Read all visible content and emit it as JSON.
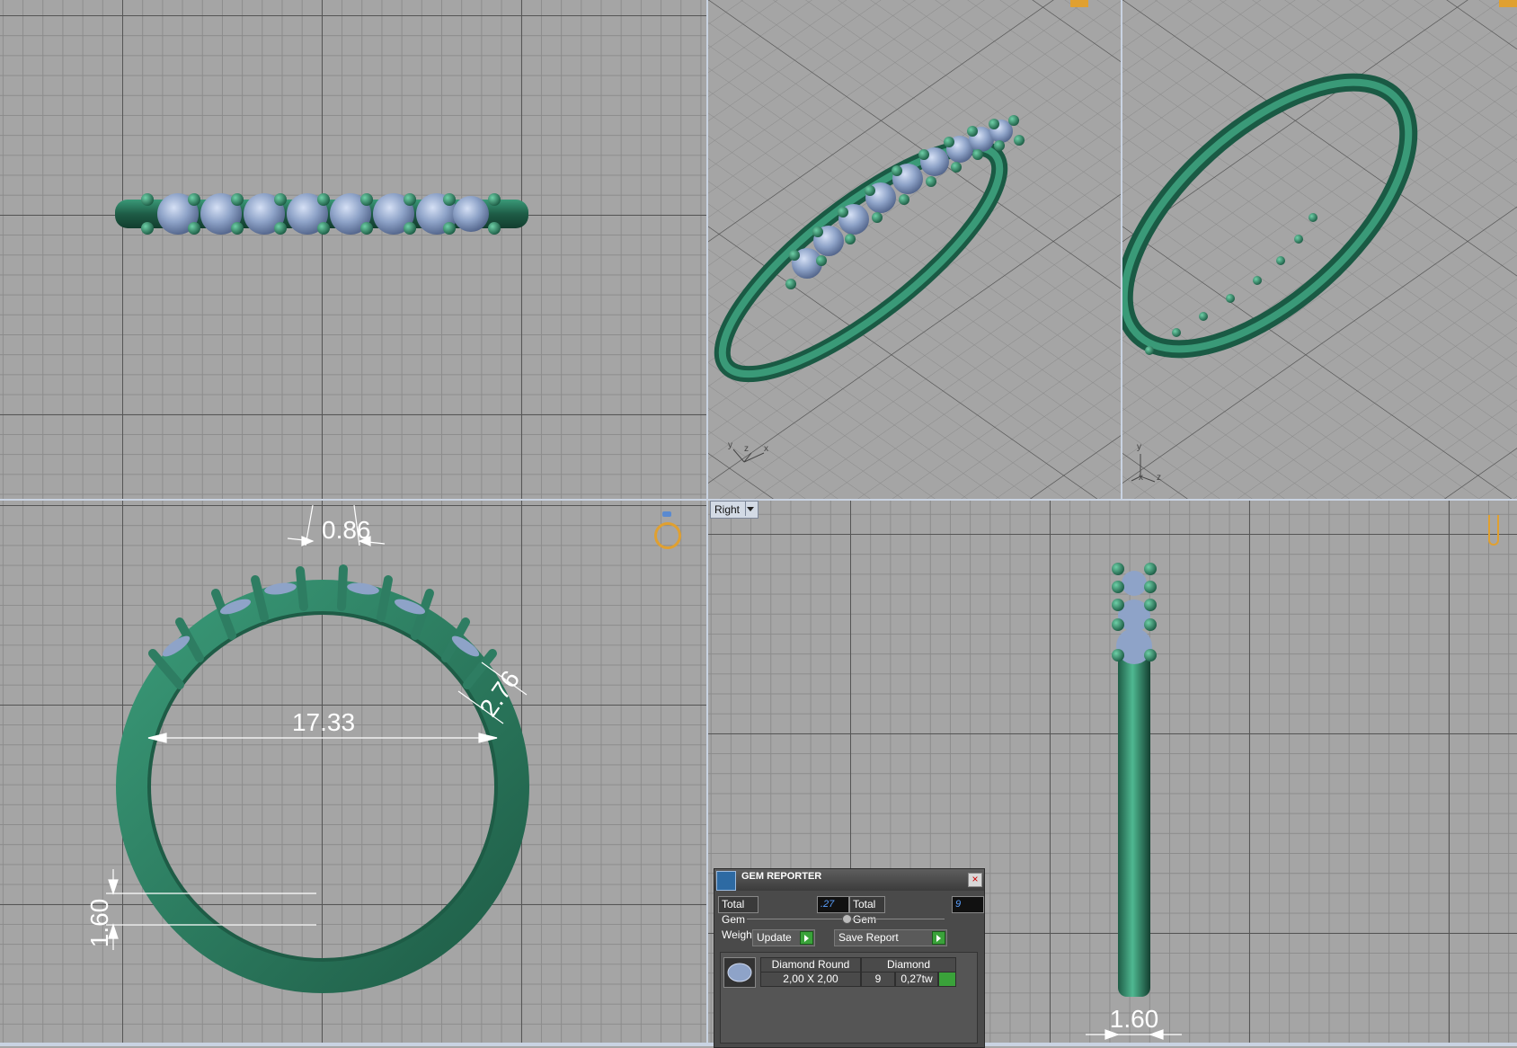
{
  "viewports": {
    "top": {},
    "perspective_a": {
      "axis_labels": [
        "y",
        "z",
        "x"
      ]
    },
    "perspective_b": {
      "axis_labels": [
        "y",
        "x",
        "z"
      ]
    },
    "front": {
      "dimensions": {
        "prong_width": "0.86",
        "band_width": "2.76",
        "inner_diameter": "17.33",
        "band_thickness": "1.60"
      },
      "gizmo_icon": "ring-view-icon"
    },
    "right": {
      "view_selector": "Right",
      "dimensions": {
        "band_width": "1.60"
      },
      "gizmo_icon": "side-view-icon"
    }
  },
  "gem_reporter": {
    "title": "GEM REPORTER",
    "total_gem_weight_label": "Total Gem Weight",
    "total_gem_weight": ".27",
    "total_gem_count_label": "Total Gem Count",
    "total_gem_count": "9",
    "update_label": "Update",
    "save_report_label": "Save Report",
    "rows": [
      {
        "shape": "Diamond Round",
        "material": "Diamond",
        "size": "2,00 X 2,00",
        "count": "9",
        "weight": "0,27tw"
      }
    ]
  },
  "colors": {
    "metal": "#2e7d62",
    "gem": "#8ea3c8",
    "viewport_bg": "#a5a5a5",
    "accent": "#e0a030"
  }
}
